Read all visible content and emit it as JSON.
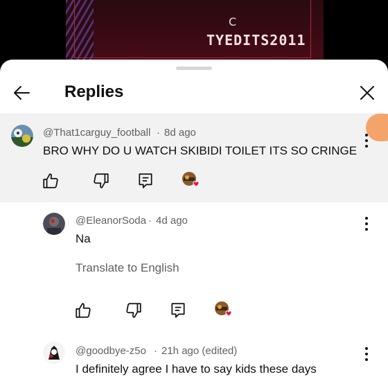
{
  "video": {
    "letter": "C",
    "watermark": "TYEDITS2011"
  },
  "header": {
    "title": "Replies"
  },
  "parent_comment": {
    "author": "@That1carguy_football",
    "age": "8d ago",
    "text": "BRO WHY DO U WATCH SKIBIDI TOILET ITS SO CRINGE"
  },
  "replies": [
    {
      "author": "@EleanorSoda",
      "age": "4d ago",
      "text": "Na",
      "translate": "Translate to English"
    },
    {
      "author": "@goodbye-z5o",
      "age": "21h ago (edited)",
      "text": "I definitely agree I have to say kids these days"
    }
  ],
  "colors": {
    "accent_heart": "#ff0033",
    "fab": "#f4a46a"
  },
  "icons": [
    "back-arrow-icon",
    "close-icon",
    "thumbs-up-icon",
    "thumbs-down-icon",
    "reply-icon",
    "creator-heart-icon",
    "more-vert-icon"
  ]
}
